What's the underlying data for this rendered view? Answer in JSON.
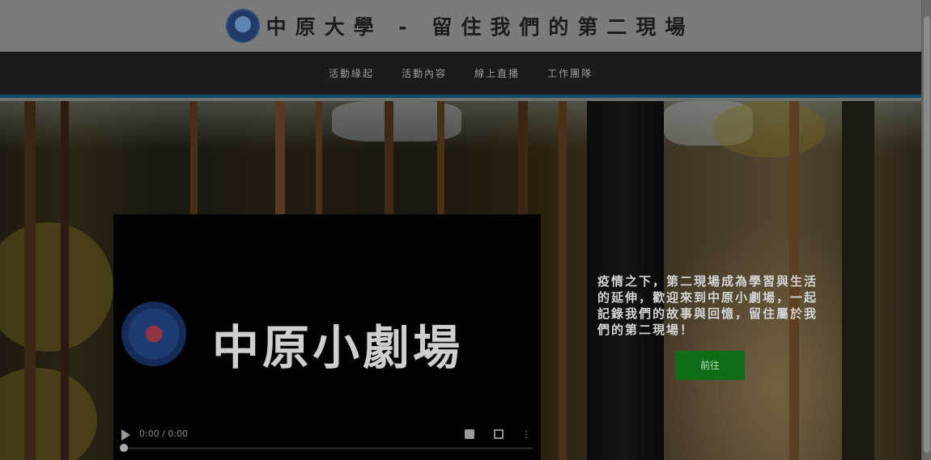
{
  "header": {
    "title": "中原大學 - 留住我們的第二現場"
  },
  "nav": {
    "items": [
      {
        "label": "活動緣起"
      },
      {
        "label": "活動內容"
      },
      {
        "label": "線上直播"
      },
      {
        "label": "工作團隊"
      }
    ]
  },
  "video": {
    "title": "中原小劇場",
    "time": "0:00 / 0:00"
  },
  "promo": {
    "text": "疫情之下，第二現場成為學習與生活的延伸，歡迎來到中原小劇場，一起記錄我們的故事與回憶，留住屬於我們的第二現場！",
    "button_label": "前往"
  },
  "colors": {
    "nav_bg": "#1b1b1b",
    "nav_accent": "#0d4c68",
    "button_green": "#0f6c17",
    "overlay": "#6f6f6f"
  }
}
